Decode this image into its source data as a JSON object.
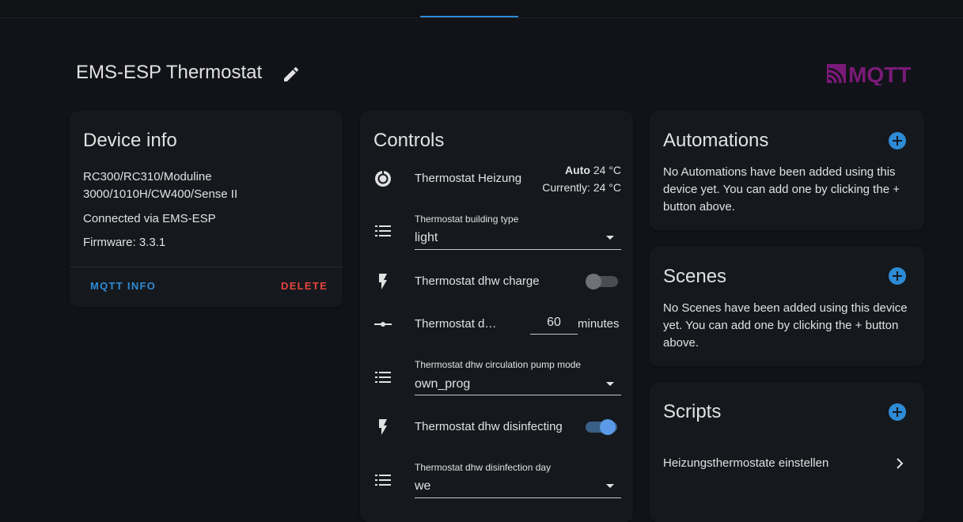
{
  "header": {
    "title": "EMS-ESP Thermostat",
    "logo_text": "MQTT",
    "logo_color": "#7a1a78"
  },
  "device_info": {
    "title": "Device info",
    "model_line1": "RC300/RC310/Moduline",
    "model_line2": "3000/1010H/CW400/Sense II",
    "connected": "Connected via EMS-ESP",
    "firmware": "Firmware: 3.3.1",
    "mqtt_info_label": "MQTT INFO",
    "delete_label": "DELETE"
  },
  "controls": {
    "title": "Controls",
    "thermostat": {
      "label": "Thermostat Heizung",
      "mode": "Auto",
      "target": "24 °C",
      "current": "Currently: 24 °C"
    },
    "building_type": {
      "label": "Thermostat building type",
      "value": "light"
    },
    "dhw_charge": {
      "label": "Thermostat dhw charge",
      "on": false
    },
    "dhw_number": {
      "label": "Thermostat d…",
      "value": "60",
      "unit": "minutes"
    },
    "circ_pump": {
      "label": "Thermostat dhw circulation pump mode",
      "value": "own_prog"
    },
    "dhw_disinfecting": {
      "label": "Thermostat dhw disinfecting",
      "on": true
    },
    "disinfection_day": {
      "label": "Thermostat dhw disinfection day",
      "value": "we"
    }
  },
  "automations": {
    "title": "Automations",
    "text": "No Automations have been added using this device yet. You can add one by clicking the + button above."
  },
  "scenes": {
    "title": "Scenes",
    "text": "No Scenes have been added using this device yet. You can add one by clicking the + button above."
  },
  "scripts": {
    "title": "Scripts",
    "item": "Heizungsthermostate einstellen"
  },
  "colors": {
    "accent": "#2e8bd6",
    "delete": "#e5443e",
    "background": "#111318",
    "card": "#15181d"
  }
}
